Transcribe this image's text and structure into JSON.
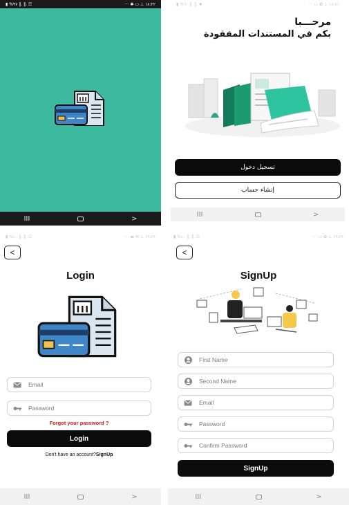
{
  "splash": {
    "status_left": "▮ %٩٧ ‖. ‖. ☷",
    "status_right": "··· ✱ ▭ ⊥ ١٨:٢٢",
    "bg_color": "#3db9a0"
  },
  "welcome": {
    "status_left": "▮ %٦٠ ‖. ‖. ✱",
    "status_right": "··· ▭ ✿ ⊥ ١٨:٤١",
    "greeting": "مرحـــبا",
    "subtitle": "بكم في المستندات المفقودة",
    "login_button": "تسجيل دخول",
    "signup_button": "إنشاء حساب"
  },
  "login": {
    "status_left": "▮ %١٠ ‖. ‖. ☷",
    "status_right": "··· ▬ ✉ ⊥ ١٩:٢٢",
    "title": "Login",
    "email_placeholder": "Email",
    "password_placeholder": "Password",
    "forgot": "Forgot your password ?",
    "login_button": "Login",
    "no_account": "Don't have an account?",
    "signup_link": "SignUp"
  },
  "signup": {
    "status_left": "▮ %١٠ ‖. ‖. ☷",
    "status_right": "··· ▭ ✿ ⊥ ١٩:٢٢",
    "title": "SignUp",
    "first_name": "First Name",
    "second_name": "Second Name",
    "email": "Email",
    "password": "Password",
    "confirm_password": "Confirm Password",
    "signup_button": "SignUp"
  },
  "nav": {
    "recent": "III",
    "back": ">"
  },
  "icons": [
    "document-card-icon",
    "back-arrow-icon",
    "mail-icon",
    "key-icon",
    "user-icon"
  ]
}
